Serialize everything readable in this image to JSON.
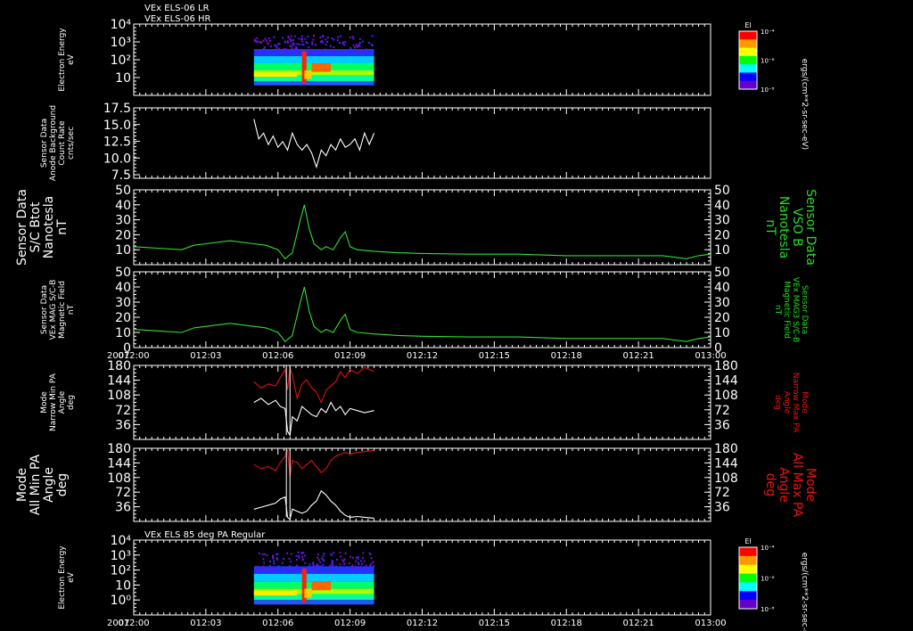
{
  "header": {
    "line1": "VEx ELS-06 LR",
    "line2": "VEx ELS-06 HR",
    "panel7_title": "VEx ELS 85 deg PA Regular"
  },
  "x_axis": {
    "year": "2007",
    "ticks": [
      "012:00",
      "012:03",
      "012:06",
      "012:09",
      "012:12",
      "012:15",
      "012:18",
      "012:21",
      "013:00"
    ]
  },
  "colorbar": {
    "label": "El",
    "units": "ergs/(cm**2-sr-sec-eV)",
    "ticks": [
      "10⁻⁴",
      "10⁻⁶",
      "10⁻⁸"
    ],
    "colors": [
      "#ff0000",
      "#ff9900",
      "#ffff00",
      "#00ff00",
      "#00ffff",
      "#0000ff",
      "#6600cc"
    ]
  },
  "colors": {
    "trace_white": "#ffffff",
    "trace_green": "#33dd33",
    "trace_red": "#dd1111",
    "label_green": "#22dd22",
    "label_red": "#ee1111"
  },
  "chart_data": [
    {
      "id": "p1",
      "type": "heatmap",
      "ylabel": [
        "Electron Energy",
        "eV"
      ],
      "ytick_labels": [
        "10⁴",
        "10³",
        "10²",
        "10"
      ],
      "activity_window": [
        "012:05",
        "012:10"
      ]
    },
    {
      "id": "p2",
      "type": "line",
      "ylabel": [
        "Sensor Data",
        "Anode Background",
        "Count Rate",
        "cnts/sec"
      ],
      "ylim": [
        5.0,
        17.5
      ],
      "ytick_labels": [
        "17.5",
        "15.0",
        "12.5",
        "10.0",
        "7.5"
      ],
      "series": [
        {
          "x": [
            5.0,
            5.2,
            5.4,
            5.6,
            5.8,
            6.0,
            6.2,
            6.4,
            6.6,
            6.8,
            7.0,
            7.2,
            7.4,
            7.6,
            7.8,
            8.0,
            8.2,
            8.4,
            8.6,
            8.8,
            9.0,
            9.2,
            9.4,
            9.6,
            9.8,
            10.0
          ],
          "y": [
            15.5,
            12,
            13,
            11,
            12.5,
            10.5,
            11.5,
            10,
            13,
            11,
            10,
            11,
            9.5,
            7,
            10,
            9,
            11,
            10,
            12,
            10.5,
            11,
            12,
            10,
            13,
            11,
            13
          ]
        }
      ]
    },
    {
      "id": "p3",
      "type": "line",
      "ylabel": [
        "Sensor Data",
        "S/C Btot",
        "Nanotesla",
        "nT"
      ],
      "ylabel_right": [
        "Sensor Data",
        "VSO B",
        "Nanotesla",
        "nT"
      ],
      "ylim": [
        0,
        50
      ],
      "ytick_labels": [
        "50",
        "40",
        "30",
        "20",
        "10"
      ],
      "series": [
        {
          "x": [
            0,
            1,
            2,
            2.5,
            3,
            4,
            5,
            5.5,
            6,
            6.3,
            6.6,
            6.9,
            7.1,
            7.3,
            7.5,
            7.8,
            8,
            8.3,
            8.6,
            8.8,
            9,
            9.3,
            10,
            11,
            12,
            14,
            16,
            18,
            20,
            22,
            22.5,
            23,
            23.5,
            24
          ],
          "y": [
            12,
            11,
            10,
            13,
            14,
            16,
            14,
            13,
            10,
            4,
            8,
            28,
            40,
            24,
            14,
            10,
            12,
            10,
            18,
            22,
            12,
            10,
            9,
            8,
            7.5,
            7,
            7,
            6,
            6,
            6,
            5,
            4,
            6,
            7
          ]
        }
      ]
    },
    {
      "id": "p4",
      "type": "line",
      "ylabel": [
        "Sensor Data",
        "VEx MAG S/C-B",
        "Magnetic Field",
        "nT"
      ],
      "ylabel_right": [
        "Sensor Data",
        "VEx MAG3 S/C-B",
        "Magnetic Field",
        "nT"
      ],
      "ylim": [
        0,
        50
      ],
      "ytick_labels": [
        "50",
        "40",
        "30",
        "20",
        "10",
        "0"
      ],
      "series": [
        {
          "x": [
            0,
            1,
            2,
            2.5,
            3,
            4,
            5,
            5.5,
            6,
            6.3,
            6.6,
            6.9,
            7.1,
            7.3,
            7.5,
            7.8,
            8,
            8.3,
            8.6,
            8.8,
            9,
            9.3,
            10,
            11,
            12,
            14,
            16,
            18,
            20,
            22,
            22.5,
            23,
            23.5,
            24
          ],
          "y": [
            12,
            11,
            10,
            13,
            14,
            16,
            14,
            13,
            10,
            4,
            8,
            28,
            40,
            24,
            14,
            10,
            12,
            10,
            18,
            22,
            12,
            10,
            9,
            8,
            7.5,
            7,
            7,
            6,
            6,
            6,
            5,
            4,
            6,
            7
          ]
        }
      ]
    },
    {
      "id": "p5",
      "type": "line",
      "ylabel": [
        "Mode",
        "Narrow Min PA",
        "Angle",
        "deg"
      ],
      "ylabel_right": [
        "Mode",
        "Narrow Max PA",
        "Angle",
        "deg"
      ],
      "ylim": [
        0,
        180
      ],
      "ytick_labels": [
        "180",
        "144",
        "108",
        "72",
        "36"
      ],
      "series": [
        {
          "x": [
            5,
            5.3,
            5.6,
            5.9,
            6.1,
            6.3,
            6.4,
            6.5,
            6.6,
            6.8,
            7,
            7.2,
            7.4,
            7.6,
            7.8,
            8,
            8.2,
            8.4,
            8.6,
            8.8,
            9,
            9.3,
            9.6,
            10
          ],
          "y": [
            90,
            100,
            85,
            95,
            80,
            75,
            20,
            10,
            55,
            45,
            80,
            70,
            60,
            55,
            75,
            65,
            90,
            70,
            80,
            60,
            75,
            70,
            65,
            70
          ]
        },
        {
          "x": [
            5,
            5.3,
            5.6,
            5.9,
            6.1,
            6.3,
            6.4,
            6.5,
            6.6,
            6.8,
            7,
            7.2,
            7.4,
            7.6,
            7.8,
            8,
            8.2,
            8.4,
            8.6,
            8.8,
            9,
            9.3,
            9.6,
            10
          ],
          "y": [
            140,
            125,
            135,
            130,
            150,
            170,
            120,
            175,
            155,
            100,
            135,
            145,
            125,
            115,
            90,
            120,
            130,
            140,
            165,
            150,
            170,
            160,
            175,
            165
          ]
        }
      ]
    },
    {
      "id": "p6",
      "type": "line",
      "ylabel": [
        "Mode",
        "All Min PA",
        "Angle",
        "deg"
      ],
      "ylabel_right": [
        "Mode",
        "All Max PA",
        "Angle",
        "deg"
      ],
      "ylim": [
        0,
        180
      ],
      "ytick_labels": [
        "180",
        "144",
        "108",
        "72",
        "36"
      ],
      "series": [
        {
          "x": [
            5,
            5.3,
            5.6,
            5.9,
            6.1,
            6.3,
            6.4,
            6.5,
            6.6,
            6.8,
            7,
            7.2,
            7.4,
            7.6,
            7.8,
            8,
            8.2,
            8.4,
            8.6,
            8.8,
            9,
            9.3,
            9.6,
            10
          ],
          "y": [
            30,
            35,
            40,
            45,
            55,
            60,
            10,
            5,
            30,
            25,
            20,
            25,
            40,
            50,
            75,
            65,
            50,
            40,
            25,
            15,
            10,
            12,
            10,
            8
          ]
        },
        {
          "x": [
            5,
            5.3,
            5.6,
            5.9,
            6.1,
            6.3,
            6.4,
            6.5,
            6.6,
            6.8,
            7,
            7.2,
            7.4,
            7.6,
            7.8,
            8,
            8.2,
            8.4,
            8.6,
            8.8,
            9,
            9.3,
            9.6,
            10
          ],
          "y": [
            140,
            130,
            135,
            125,
            145,
            160,
            180,
            110,
            150,
            145,
            130,
            140,
            150,
            135,
            120,
            130,
            150,
            160,
            165,
            170,
            165,
            170,
            172,
            175
          ]
        }
      ]
    },
    {
      "id": "p7",
      "type": "heatmap",
      "ylabel": [
        "Electron Energy",
        "eV"
      ],
      "ytick_labels": [
        "10⁴",
        "10³",
        "10²",
        "10",
        "10⁰"
      ],
      "activity_window": [
        "012:05",
        "012:10"
      ]
    }
  ]
}
